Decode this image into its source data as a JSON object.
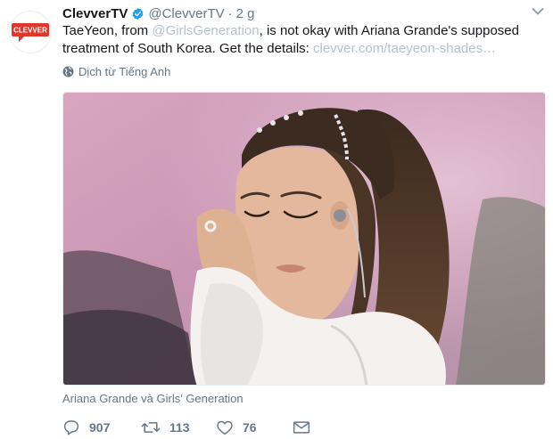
{
  "tweet": {
    "avatar_text": "CLEVVER",
    "display_name": "ClevverTV",
    "handle": "@ClevverTV",
    "separator": "·",
    "time": "2 g",
    "text_1": "TaeYeon, from ",
    "mention": "@GirlsGeneration",
    "text_2": ", is not okay with Ariana Grande's supposed treatment of South Korea. Get the details: ",
    "link": "clevver.com/taeyeon-shades…",
    "translate_label": "Dịch từ Tiếng Anh",
    "caption": "Ariana Grande và Girls' Generation"
  },
  "actions": {
    "replies": "907",
    "retweets": "113",
    "likes": "76"
  },
  "icons": [
    "clevver-logo-icon",
    "verified-badge-icon",
    "chevron-down-icon",
    "globe-icon",
    "reply-icon",
    "retweet-icon",
    "like-icon",
    "message-icon"
  ],
  "colors": {
    "brand_red": "#e0362c",
    "verified_blue": "#1da1f2",
    "muted_text": "#657786",
    "link": "#b3c2cc"
  }
}
